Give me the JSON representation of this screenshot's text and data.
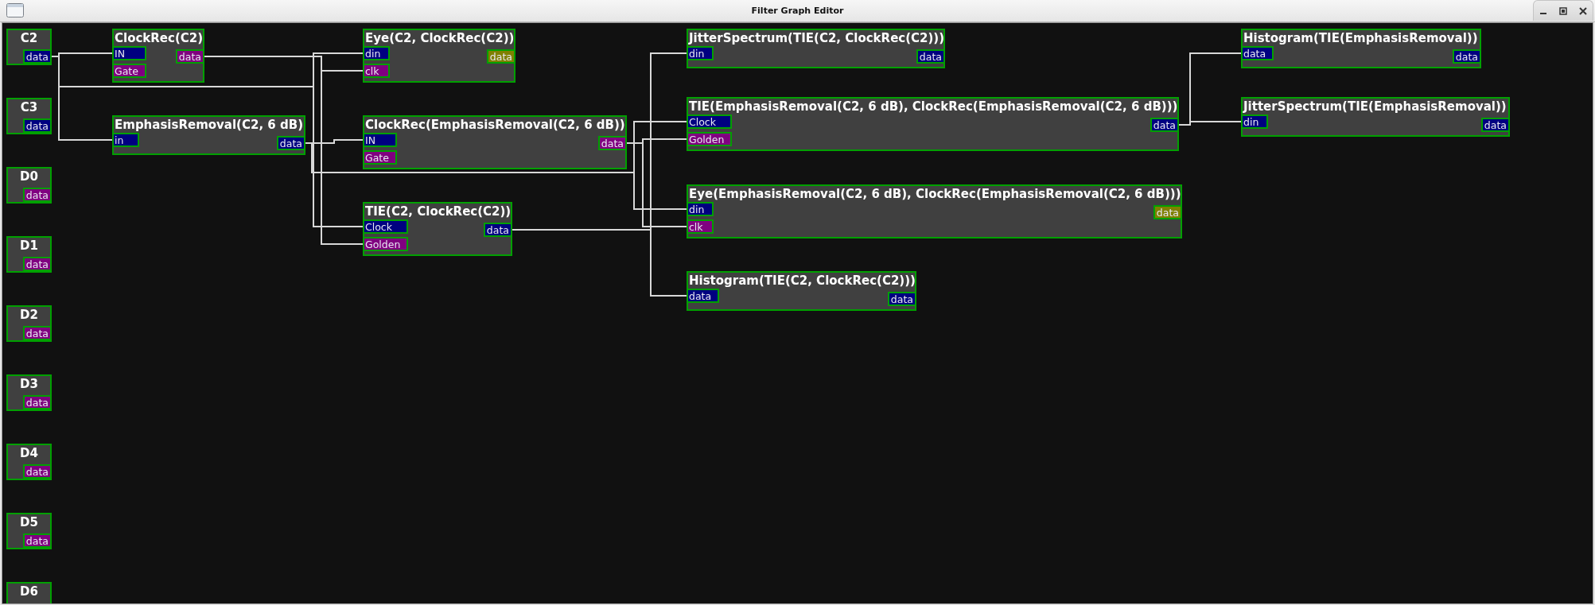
{
  "window": {
    "title": "Filter Graph Editor"
  },
  "sources": [
    {
      "label": "C2",
      "outputs": [
        {
          "label": "data",
          "color": "#000080"
        }
      ]
    },
    {
      "label": "C3",
      "outputs": [
        {
          "label": "data",
          "color": "#000080"
        }
      ]
    },
    {
      "label": "D0",
      "outputs": [
        {
          "label": "data",
          "color": "#800080"
        }
      ]
    },
    {
      "label": "D1",
      "outputs": [
        {
          "label": "data",
          "color": "#800080"
        }
      ]
    },
    {
      "label": "D2",
      "outputs": [
        {
          "label": "data",
          "color": "#800080"
        }
      ]
    },
    {
      "label": "D3",
      "outputs": [
        {
          "label": "data",
          "color": "#800080"
        }
      ]
    },
    {
      "label": "D4",
      "outputs": [
        {
          "label": "data",
          "color": "#800080"
        }
      ]
    },
    {
      "label": "D5",
      "outputs": [
        {
          "label": "data",
          "color": "#800080"
        }
      ]
    },
    {
      "label": "D6"
    }
  ],
  "filters": [
    {
      "title": "ClockRec(C2)",
      "inputs": [
        {
          "label": "IN",
          "color": "#000080"
        },
        {
          "label": "Gate",
          "color": "#800080"
        }
      ],
      "outputs": [
        {
          "label": "data",
          "color": "#800080"
        }
      ]
    },
    {
      "title": "EmphasisRemoval(C2, 6 dB)",
      "inputs": [
        {
          "label": "in",
          "color": "#000080"
        }
      ],
      "outputs": [
        {
          "label": "data",
          "color": "#000080"
        }
      ]
    },
    {
      "title": "Eye(C2, ClockRec(C2))",
      "inputs": [
        {
          "label": "din",
          "color": "#000080"
        },
        {
          "label": "clk",
          "color": "#800080"
        }
      ],
      "outputs": [
        {
          "label": "data",
          "color": "#808000"
        }
      ]
    },
    {
      "title": "ClockRec(EmphasisRemoval(C2, 6 dB))",
      "inputs": [
        {
          "label": "IN",
          "color": "#000080"
        },
        {
          "label": "Gate",
          "color": "#800080"
        }
      ],
      "outputs": [
        {
          "label": "data",
          "color": "#800080"
        }
      ]
    },
    {
      "title": "TIE(C2, ClockRec(C2))",
      "inputs": [
        {
          "label": "Clock",
          "color": "#000080"
        },
        {
          "label": "Golden",
          "color": "#800080"
        }
      ],
      "outputs": [
        {
          "label": "data",
          "color": "#000080"
        }
      ]
    },
    {
      "title": "JitterSpectrum(TIE(C2, ClockRec(C2)))",
      "inputs": [
        {
          "label": "din",
          "color": "#000080"
        }
      ],
      "outputs": [
        {
          "label": "data",
          "color": "#000080"
        }
      ]
    },
    {
      "title": "TIE(EmphasisRemoval(C2, 6 dB), ClockRec(EmphasisRemoval(C2, 6 dB)))",
      "inputs": [
        {
          "label": "Clock",
          "color": "#000080"
        },
        {
          "label": "Golden",
          "color": "#800080"
        }
      ],
      "outputs": [
        {
          "label": "data",
          "color": "#000080"
        }
      ]
    },
    {
      "title": "Eye(EmphasisRemoval(C2, 6 dB), ClockRec(EmphasisRemoval(C2, 6 dB)))",
      "inputs": [
        {
          "label": "din",
          "color": "#000080"
        },
        {
          "label": "clk",
          "color": "#800080"
        }
      ],
      "outputs": [
        {
          "label": "data",
          "color": "#808000"
        }
      ]
    },
    {
      "title": "Histogram(TIE(C2, ClockRec(C2)))",
      "inputs": [
        {
          "label": "data",
          "color": "#000080"
        }
      ],
      "outputs": [
        {
          "label": "data",
          "color": "#000080"
        }
      ]
    },
    {
      "title": "Histogram(TIE(EmphasisRemoval))",
      "inputs": [
        {
          "label": "data",
          "color": "#000080"
        }
      ],
      "outputs": [
        {
          "label": "data",
          "color": "#000080"
        }
      ]
    },
    {
      "title": "JitterSpectrum(TIE(EmphasisRemoval))",
      "inputs": [
        {
          "label": "din",
          "color": "#000080"
        }
      ],
      "outputs": [
        {
          "label": "data",
          "color": "#000080"
        }
      ]
    }
  ]
}
